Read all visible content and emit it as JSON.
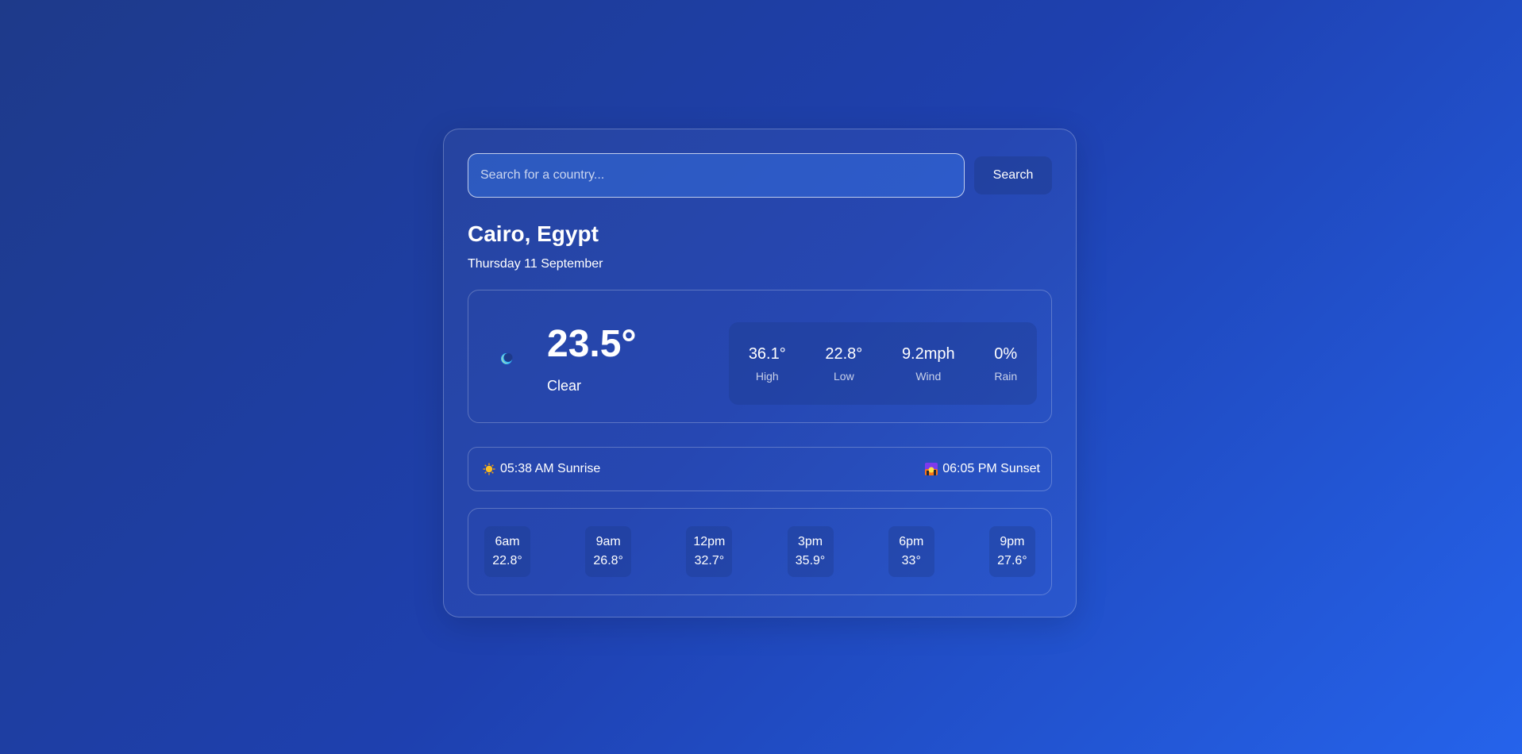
{
  "search": {
    "placeholder": "Search for a country...",
    "button_label": "Search"
  },
  "location": {
    "name": "Cairo, Egypt",
    "date": "Thursday 11 September"
  },
  "current": {
    "icon": "moon-icon",
    "temperature": "23.5°",
    "condition": "Clear",
    "stats": [
      {
        "value": "36.1°",
        "label": "High"
      },
      {
        "value": "22.8°",
        "label": "Low"
      },
      {
        "value": "9.2mph",
        "label": "Wind"
      },
      {
        "value": "0%",
        "label": "Rain"
      }
    ]
  },
  "sun": {
    "sunrise_icon": "sun-icon",
    "sunrise": "05:38 AM Sunrise",
    "sunset_icon": "sunset-icon",
    "sunset": "06:05 PM Sunset"
  },
  "hourly": [
    {
      "time": "6am",
      "temp": "22.8°"
    },
    {
      "time": "9am",
      "temp": "26.8°"
    },
    {
      "time": "12pm",
      "temp": "32.7°"
    },
    {
      "time": "3pm",
      "temp": "35.9°"
    },
    {
      "time": "6pm",
      "temp": "33°"
    },
    {
      "time": "9pm",
      "temp": "27.6°"
    }
  ],
  "colors": {
    "background_start": "#1e3a8a",
    "background_end": "#2563eb",
    "text": "#ffffff"
  }
}
